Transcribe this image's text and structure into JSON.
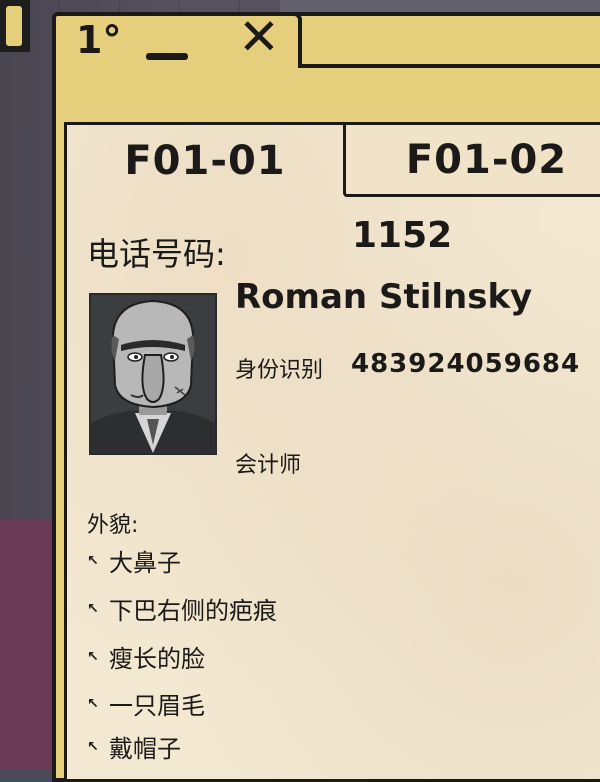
{
  "window": {
    "title_buttons": {
      "info": "1°",
      "close": "✕"
    }
  },
  "tabs": [
    {
      "label": "F01-01",
      "active": true
    },
    {
      "label": "F01-02",
      "active": false
    }
  ],
  "record": {
    "phone_label": "电话号码:",
    "phone_value": "1152",
    "name": "Roman Stilnsky",
    "id_label": "身份识别",
    "id_value": "483924059684",
    "occupation": "会计师",
    "appearance_label": "外貌:",
    "traits": [
      "大鼻子",
      "下巴右侧的疤痕",
      "瘦长的脸",
      "一只眉毛",
      "戴帽子"
    ],
    "trait_bullet": "↖"
  },
  "colors": {
    "window_frame": "#e6cf7c",
    "paper": "#f3e8d2",
    "ink": "#1c1a18"
  }
}
